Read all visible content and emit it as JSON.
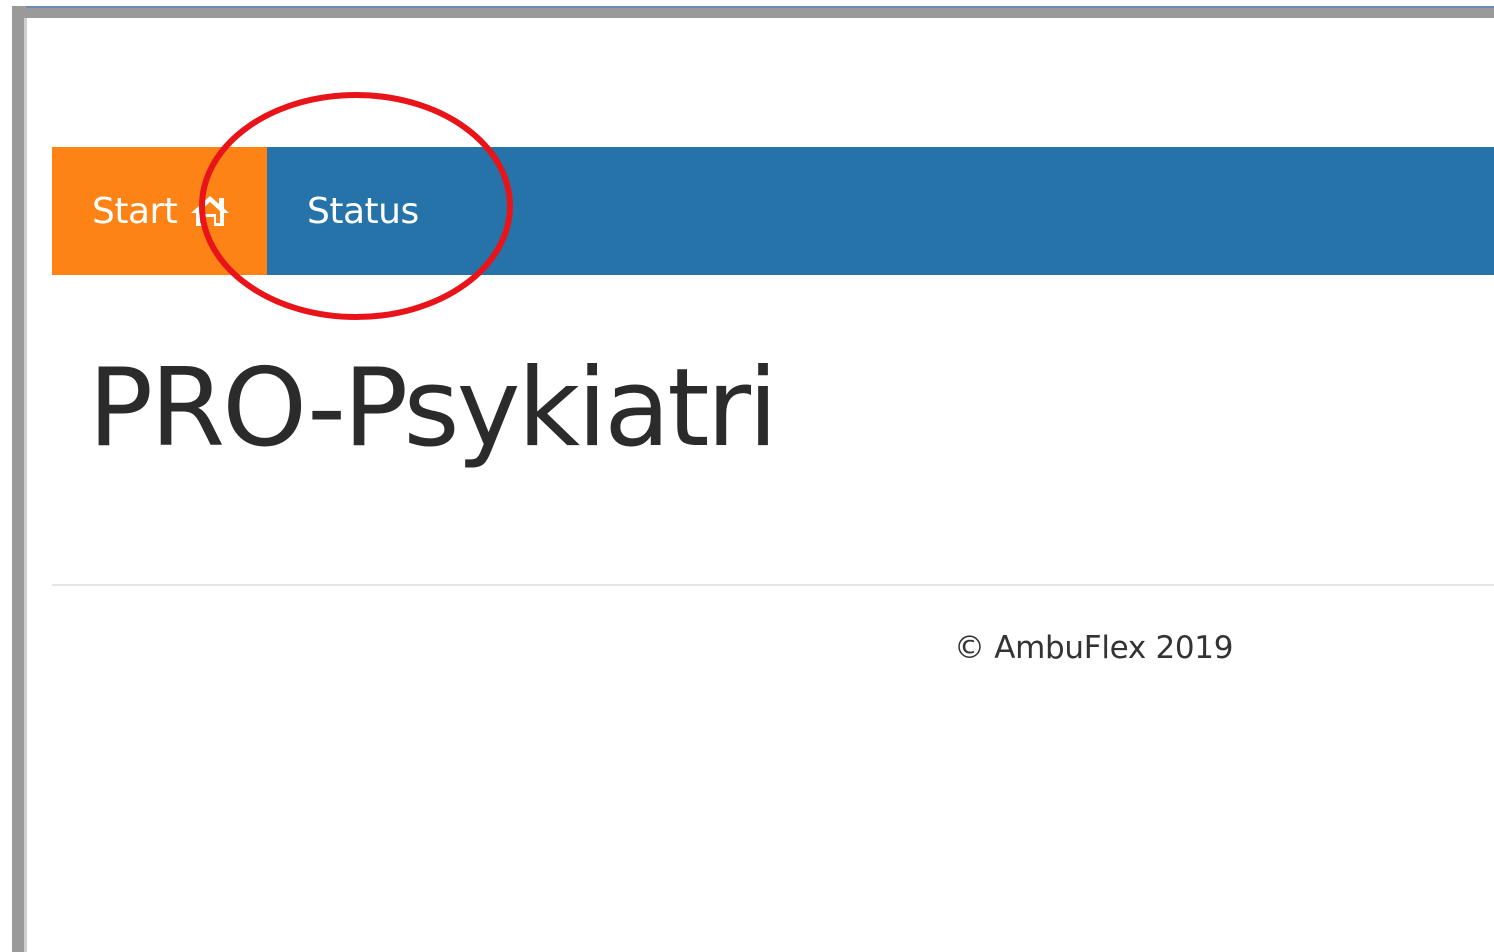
{
  "navbar": {
    "start_label": "Start",
    "start_icon": "home-icon",
    "status_label": "Status",
    "start_color": "#fd8316",
    "bar_color": "#2573a8"
  },
  "main": {
    "title": "PRO-Psykiatri"
  },
  "footer": {
    "copyright": "© AmbuFlex 2019"
  },
  "annotation": {
    "color": "#e8141a"
  }
}
